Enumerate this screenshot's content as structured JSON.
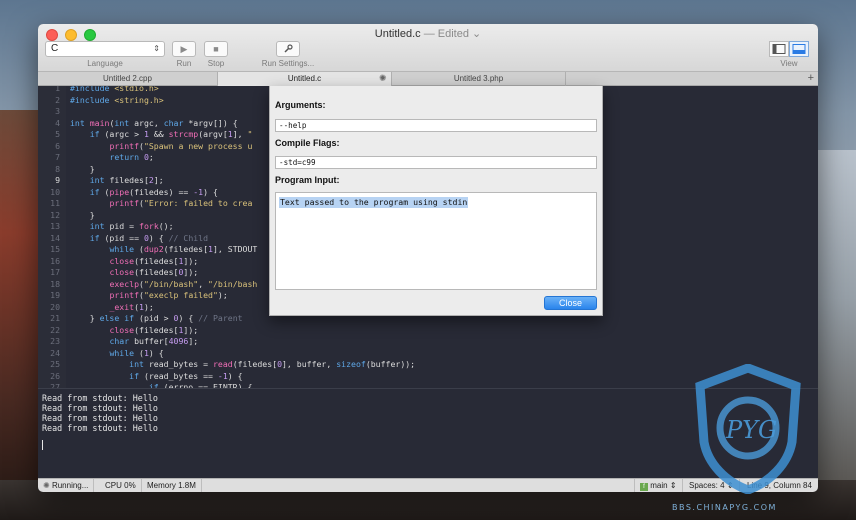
{
  "window": {
    "title": "Untitled.c",
    "edited_label": "Edited",
    "title_chevron": "⌄"
  },
  "toolbar": {
    "language_value": "C",
    "language_label": "Language",
    "run_label": "Run",
    "stop_label": "Stop",
    "run_settings_label": "Run Settings...",
    "view_label": "View"
  },
  "tabs": [
    {
      "label": "Untitled 2.cpp",
      "active": false
    },
    {
      "label": "Untitled.c",
      "active": true
    },
    {
      "label": "Untitled 3.php",
      "active": false
    }
  ],
  "editor": {
    "current_line": 9,
    "lines": [
      {
        "n": "1",
        "html": "<span class=\"kw\">#include</span> <span class=\"st\">&lt;stdio.h&gt;</span>"
      },
      {
        "n": "2",
        "html": "<span class=\"kw\">#include</span> <span class=\"st\">&lt;string.h&gt;</span>"
      },
      {
        "n": "3",
        "html": ""
      },
      {
        "n": "4",
        "html": "<span class=\"kw\">int</span> <span class=\"fn\">main</span>(<span class=\"kw\">int</span> argc, <span class=\"kw\">char</span> *argv[]) {"
      },
      {
        "n": "5",
        "html": "    <span class=\"kw\">if</span> (argc &gt; <span class=\"nm\">1</span> &amp;&amp; <span class=\"fn\">strcmp</span>(argv[<span class=\"nm\">1</span>], <span class=\"st\">\"</span>"
      },
      {
        "n": "6",
        "html": "        <span class=\"fn\">printf</span>(<span class=\"st\">\"Spawn a new process u</span>"
      },
      {
        "n": "7",
        "html": "        <span class=\"kw\">return</span> <span class=\"nm\">0</span>;"
      },
      {
        "n": "8",
        "html": "    }"
      },
      {
        "n": "9",
        "html": "    <span class=\"kw\">int</span> filedes[<span class=\"nm\">2</span>];"
      },
      {
        "n": "10",
        "html": "    <span class=\"kw\">if</span> (<span class=\"fn\">pipe</span>(filedes) == <span class=\"nm\">-1</span>) {"
      },
      {
        "n": "11",
        "html": "        <span class=\"fn\">printf</span>(<span class=\"st\">\"Error: failed to crea</span>"
      },
      {
        "n": "12",
        "html": "    }"
      },
      {
        "n": "13",
        "html": "    <span class=\"kw\">int</span> pid = <span class=\"fn\">fork</span>();"
      },
      {
        "n": "14",
        "html": "    <span class=\"kw\">if</span> (pid == <span class=\"nm\">0</span>) { <span class=\"cm\">// Child</span>"
      },
      {
        "n": "15",
        "html": "        <span class=\"kw\">while</span> (<span class=\"fn\">dup2</span>(filedes[<span class=\"nm\">1</span>], STDOUT"
      },
      {
        "n": "16",
        "html": "        <span class=\"fn\">close</span>(filedes[<span class=\"nm\">1</span>]);"
      },
      {
        "n": "17",
        "html": "        <span class=\"fn\">close</span>(filedes[<span class=\"nm\">0</span>]);"
      },
      {
        "n": "18",
        "html": "        <span class=\"fn\">execlp</span>(<span class=\"st\">\"/bin/bash\"</span>, <span class=\"st\">\"/bin/bash</span>"
      },
      {
        "n": "19",
        "html": "        <span class=\"fn\">printf</span>(<span class=\"st\">\"execlp failed\"</span>);"
      },
      {
        "n": "20",
        "html": "        <span class=\"fn\">_exit</span>(<span class=\"nm\">1</span>);"
      },
      {
        "n": "21",
        "html": "    } <span class=\"kw\">else if</span> (pid &gt; <span class=\"nm\">0</span>) { <span class=\"cm\">// Parent</span>"
      },
      {
        "n": "22",
        "html": "        <span class=\"fn\">close</span>(filedes[<span class=\"nm\">1</span>]);"
      },
      {
        "n": "23",
        "html": "        <span class=\"kw\">char</span> buffer[<span class=\"nm\">4096</span>];"
      },
      {
        "n": "24",
        "html": "        <span class=\"kw\">while</span> (<span class=\"nm\">1</span>) {"
      },
      {
        "n": "25",
        "html": "            <span class=\"kw\">int</span> read_bytes = <span class=\"fn\">read</span>(filedes[<span class=\"nm\">0</span>], buffer, <span class=\"kw\">sizeof</span>(buffer));"
      },
      {
        "n": "26",
        "html": "            <span class=\"kw\">if</span> (read_bytes == <span class=\"nm\">-1</span>) {"
      },
      {
        "n": "27",
        "html": "                <span class=\"kw\">if</span> (errno == EINTR) {"
      }
    ]
  },
  "console": {
    "lines": [
      "Read from stdout: Hello",
      "Read from stdout: Hello",
      "Read from stdout: Hello",
      "Read from stdout: Hello"
    ]
  },
  "statusbar": {
    "running_label": "Running...",
    "cpu_label": "CPU 0%",
    "memory_label": "Memory 1.8M",
    "branch_label": "main",
    "spaces_label": "Spaces: 4",
    "position_label": "Line 9, Column 84"
  },
  "sheet": {
    "arguments_label": "Arguments:",
    "arguments_value": "--help",
    "compile_flags_label": "Compile Flags:",
    "compile_flags_value": "-std=c99",
    "program_input_label": "Program Input:",
    "program_input_value": "Text passed to the program using stdin",
    "close_label": "Close"
  },
  "watermark": {
    "text": "BBS.CHINAPYG.COM",
    "mark": "PYG"
  },
  "colors": {
    "editor_bg": "#282a36",
    "keyword": "#5fa8e8",
    "function": "#f06eb6",
    "string": "#d9c17a",
    "number": "#c59cf0",
    "close_button": "#2a84ec"
  }
}
